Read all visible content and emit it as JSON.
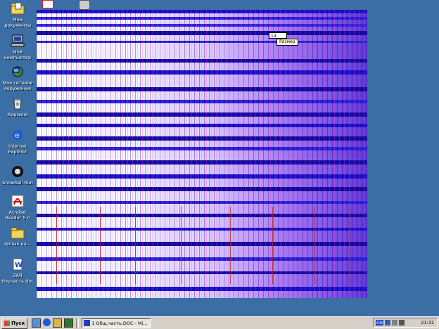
{
  "desktop": {
    "icons": [
      {
        "name": "my-documents",
        "label": "Мои\nдокументы",
        "icon": "folder-documents-icon"
      },
      {
        "name": "my-computer",
        "label": "Мой\nкомпьютер",
        "icon": "computer-icon"
      },
      {
        "name": "network-places",
        "label": "Мое сетевое\nокружение",
        "icon": "network-icon"
      },
      {
        "name": "recycle-bin",
        "label": "Корзина",
        "icon": "recycle-bin-icon"
      },
      {
        "name": "internet-explorer",
        "label": "Internet\nExplorer",
        "icon": "internet-explorer-icon"
      },
      {
        "name": "snowball-run",
        "label": "Snowball Run",
        "icon": "snowball-icon"
      },
      {
        "name": "acrobat-reader",
        "label": "Acrobat\nReader 5.0",
        "icon": "acrobat-icon"
      },
      {
        "name": "folder-shortcut",
        "label": "ярлык на...",
        "icon": "folder-icon"
      },
      {
        "name": "word-document",
        "label": "ЗАЯ\nНеучасть.doc",
        "icon": "word-document-icon"
      }
    ]
  },
  "window": {
    "spinner_value": "14",
    "tooltip": "Размер"
  },
  "taskbar": {
    "start_label": "Пуск",
    "task_label": "1 Общ.часть.DOC - Mi...",
    "tray_lang": "EN",
    "clock": "21:31"
  }
}
